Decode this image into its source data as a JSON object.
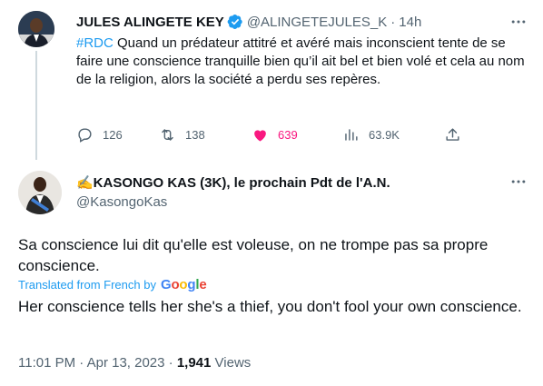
{
  "colors": {
    "accent": "#1d9bf0",
    "like": "#f91880",
    "secondary_text": "#536471",
    "primary_text": "#0f1419"
  },
  "parent_tweet": {
    "author_name": "JULES ALINGETE KEY",
    "verified_icon": "verified-badge-icon",
    "handle": "@ALINGETEJULES_K",
    "separator": "·",
    "time": "14h",
    "hashtag": "#RDC",
    "text": " Quand un prédateur attitré et avéré mais inconscient tente de se faire une conscience tranquille bien qu’il ait bel et bien volé et cela au nom de la religion, alors la société a perdu ses repères.",
    "stats": {
      "replies": "126",
      "retweets": "138",
      "likes": "639",
      "views": "63.9K"
    }
  },
  "main_tweet": {
    "author_name": "✍️KASONGO KAS (3K), le prochain Pdt de l'A.N.",
    "handle": "@KasongoKas",
    "text": "Sa conscience lui dit qu'elle est voleuse, on ne trompe pas sa propre conscience.",
    "translated_label": "Translated from French by",
    "google_letters": [
      "G",
      "o",
      "o",
      "g",
      "l",
      "e"
    ],
    "translation": "Her conscience tells her she's a thief, you don't fool your own conscience.",
    "timestamp": "11:01 PM · Apr 13, 2023 · ",
    "views_count": "1,941",
    "views_label": " Views"
  }
}
